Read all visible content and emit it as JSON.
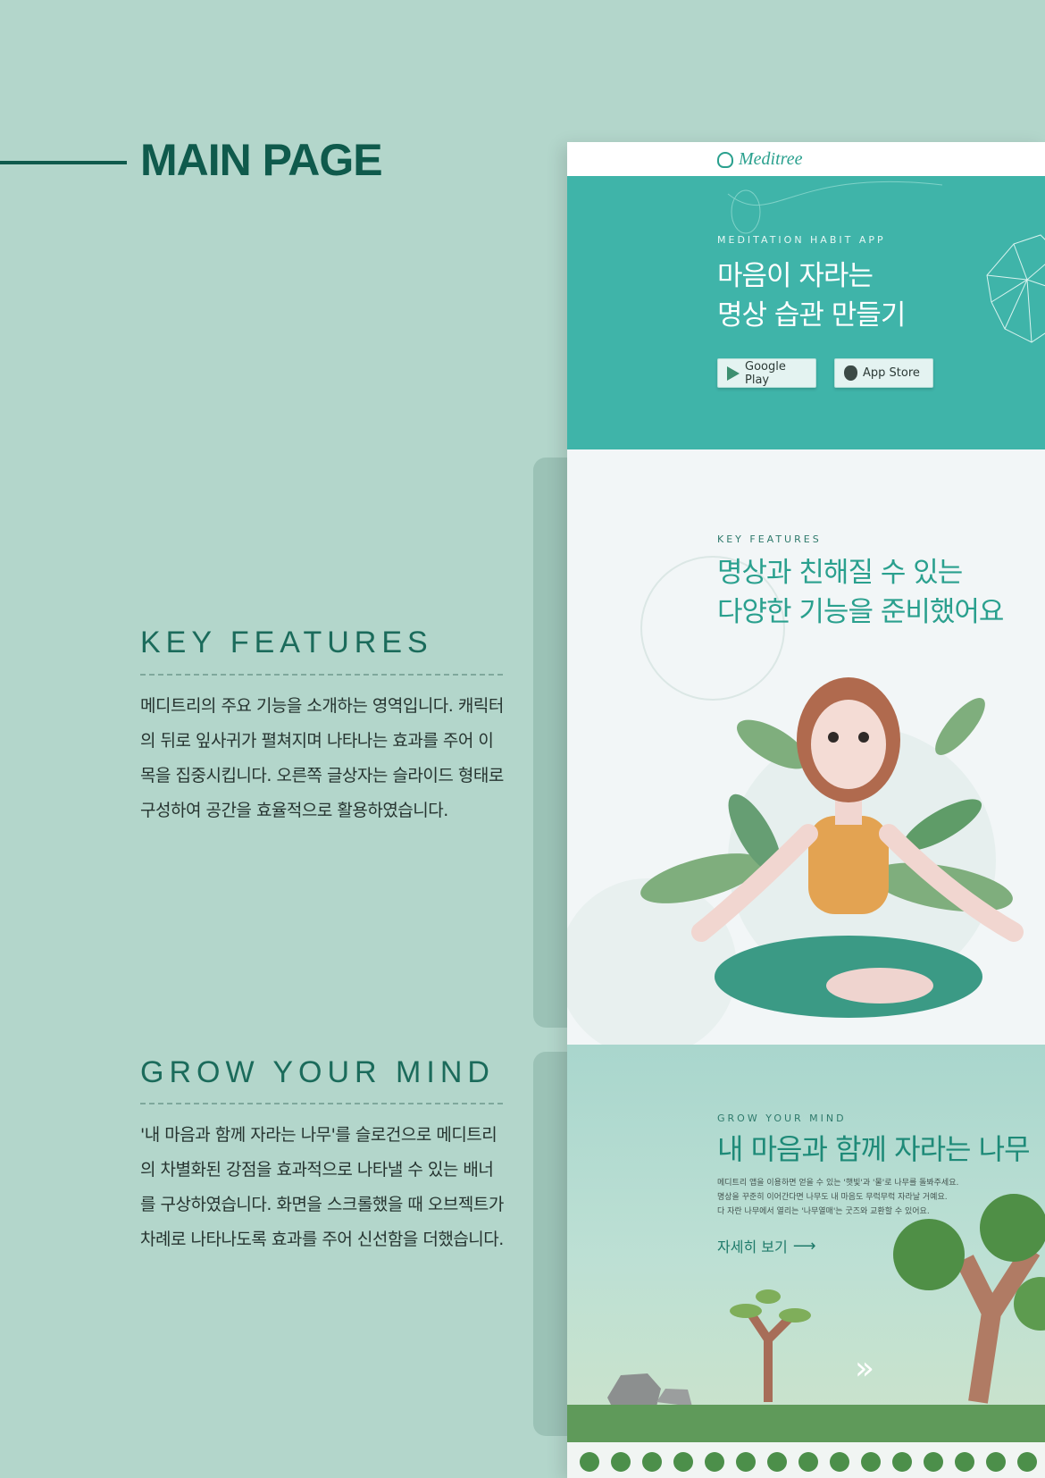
{
  "slide": {
    "title": "MAIN PAGE",
    "sections": [
      {
        "heading": "KEY FEATURES",
        "description": "메디트리의 주요 기능을 소개하는 영역입니다. 캐릭터의 뒤로 잎사귀가 펼쳐지며 나타나는 효과를 주어 이목을 집중시킵니다. 오른쪽 글상자는 슬라이드 형태로 구성하여 공간을 효율적으로 활용하였습니다."
      },
      {
        "heading": "GROW YOUR MIND",
        "description": "'내 마음과 함께 자라는 나무'를 슬로건으로 메디트리의 차별화된 강점을 효과적으로 나타낼 수 있는 배너를 구상하였습니다. 화면을 스크롤했을 때 오브젝트가 차례로 나타나도록 효과를 주어 신선함을 더했습니다."
      }
    ]
  },
  "mockup": {
    "logo": "Meditree",
    "hero": {
      "kicker": "MEDITATION HABIT APP",
      "title": "마음이 자라는\n명상 습관 만들기",
      "google_play": "Google Play",
      "app_store": "App Store"
    },
    "features": {
      "kicker": "KEY FEATURES",
      "title": "명상과 친해질 수 있는\n다양한 기능을 준비했어요"
    },
    "grow": {
      "kicker": "GROW YOUR MIND",
      "title": "내 마음과 함께 자라는 나무",
      "body": "메디트리 앱을 이용하면 얻을 수 있는 '햇빛'과 '물'로 나무를 돌봐주세요.\n명상을 꾸준히 이어간다면 나무도 내 마음도 무럭무럭 자라날 거예요.\n다 자란 나무에서 열리는 '나무열매'는 굿즈와 교환할 수 있어요.",
      "more": "자세히 보기",
      "more_arrow": "⟶",
      "next": "»"
    }
  },
  "colors": {
    "background": "#b3d6cb",
    "accent": "#0f5a4c",
    "hero": "#3fb4a9",
    "brand": "#2aa08e"
  }
}
